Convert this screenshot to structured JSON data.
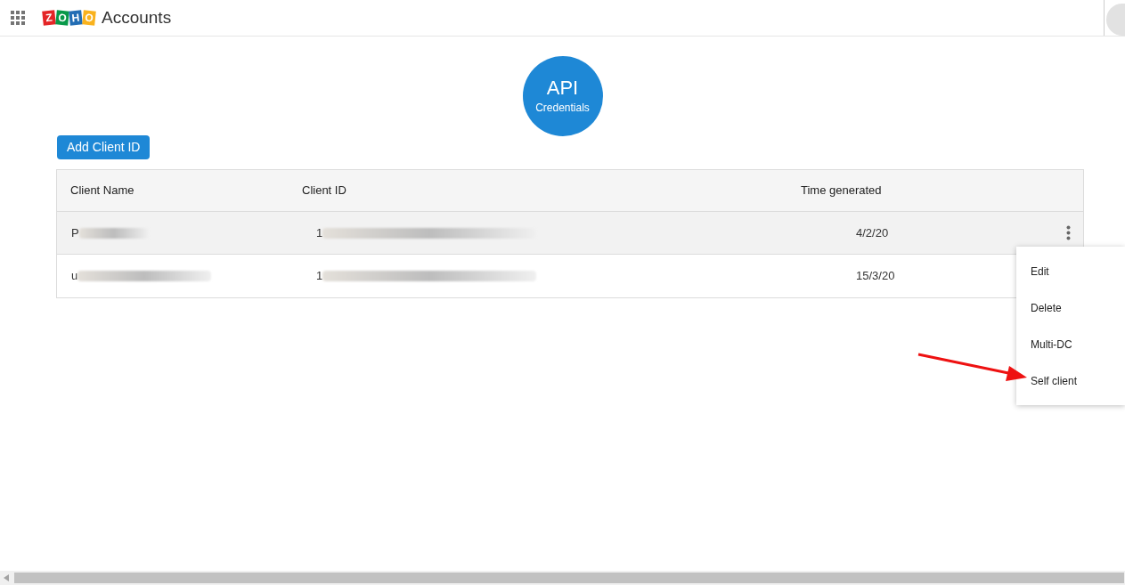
{
  "header": {
    "logo_letters": [
      {
        "letter": "Z",
        "color": "#e42527"
      },
      {
        "letter": "O",
        "color": "#089949"
      },
      {
        "letter": "H",
        "color": "#226db4"
      },
      {
        "letter": "O",
        "color": "#f9b21d"
      }
    ],
    "title": "Accounts"
  },
  "badge": {
    "title": "API",
    "subtitle": "Credentials"
  },
  "add_button": "Add Client ID",
  "table": {
    "columns": [
      "Client Name",
      "Client ID",
      "Time generated"
    ],
    "rows": [
      {
        "client_name": "P",
        "client_id": "1",
        "time_generated": "4/2/20",
        "selected": true
      },
      {
        "client_name": "u",
        "client_id": "1",
        "time_generated": "15/3/20",
        "selected": false
      }
    ]
  },
  "menu": {
    "items": [
      "Edit",
      "Delete",
      "Multi-DC",
      "Self client"
    ]
  }
}
